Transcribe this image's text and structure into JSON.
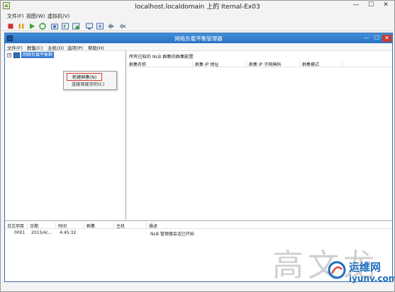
{
  "vm_window": {
    "title": "localhost.localdomain 上的 Iternal-Ex03",
    "menu": [
      "文件(F)",
      "视图(W)",
      "虚拟机(V)"
    ],
    "controls": {
      "minimize": "—",
      "maximize": "☐",
      "close": "✕"
    },
    "toolbar_icons": [
      "stop-icon",
      "pause-icon",
      "play-icon",
      "reset-icon",
      "snapshot-icon",
      "revert-icon",
      "manage-snapshots-icon",
      "console-icon",
      "settings-icon",
      "send-keys-icon"
    ]
  },
  "nlb_window": {
    "title": "网络负载平衡管理器",
    "menu": [
      "文件(F)",
      "群集(C)",
      "主机(O)",
      "选项(P)",
      "帮助(H)"
    ],
    "controls": {
      "minimize": "—",
      "maximize": "☐",
      "close": "✕"
    }
  },
  "tree": {
    "expander": "+",
    "root_label": "网络负载平衡群"
  },
  "context_menu": {
    "items": [
      "新建群集(N)",
      "连接到现存的(C)"
    ]
  },
  "right_pane": {
    "header": "所有已知的 NLB 群集的群集配置",
    "columns": [
      "群集名称",
      "群集 IP 地址",
      "群集 IP 子网掩码",
      "群集模式"
    ]
  },
  "log": {
    "columns": [
      "日志项目",
      "日期",
      "时间",
      "群集",
      "主机",
      "描述"
    ],
    "rows": [
      {
        "id": "0001",
        "date": "2015/4/...",
        "time": "4:45:32",
        "cluster": "",
        "host": "",
        "description": "NLB 管理器会话已开始"
      }
    ]
  },
  "watermark": {
    "cjk": "高文龙",
    "brand_cn": "运维网",
    "brand_url": "iyunv.com"
  },
  "colors": {
    "nlb_titlebar": "#2a72c4",
    "selection": "#3a7bd5",
    "highlight_box": "#d73b2c",
    "brand": "#1f6fbf"
  }
}
